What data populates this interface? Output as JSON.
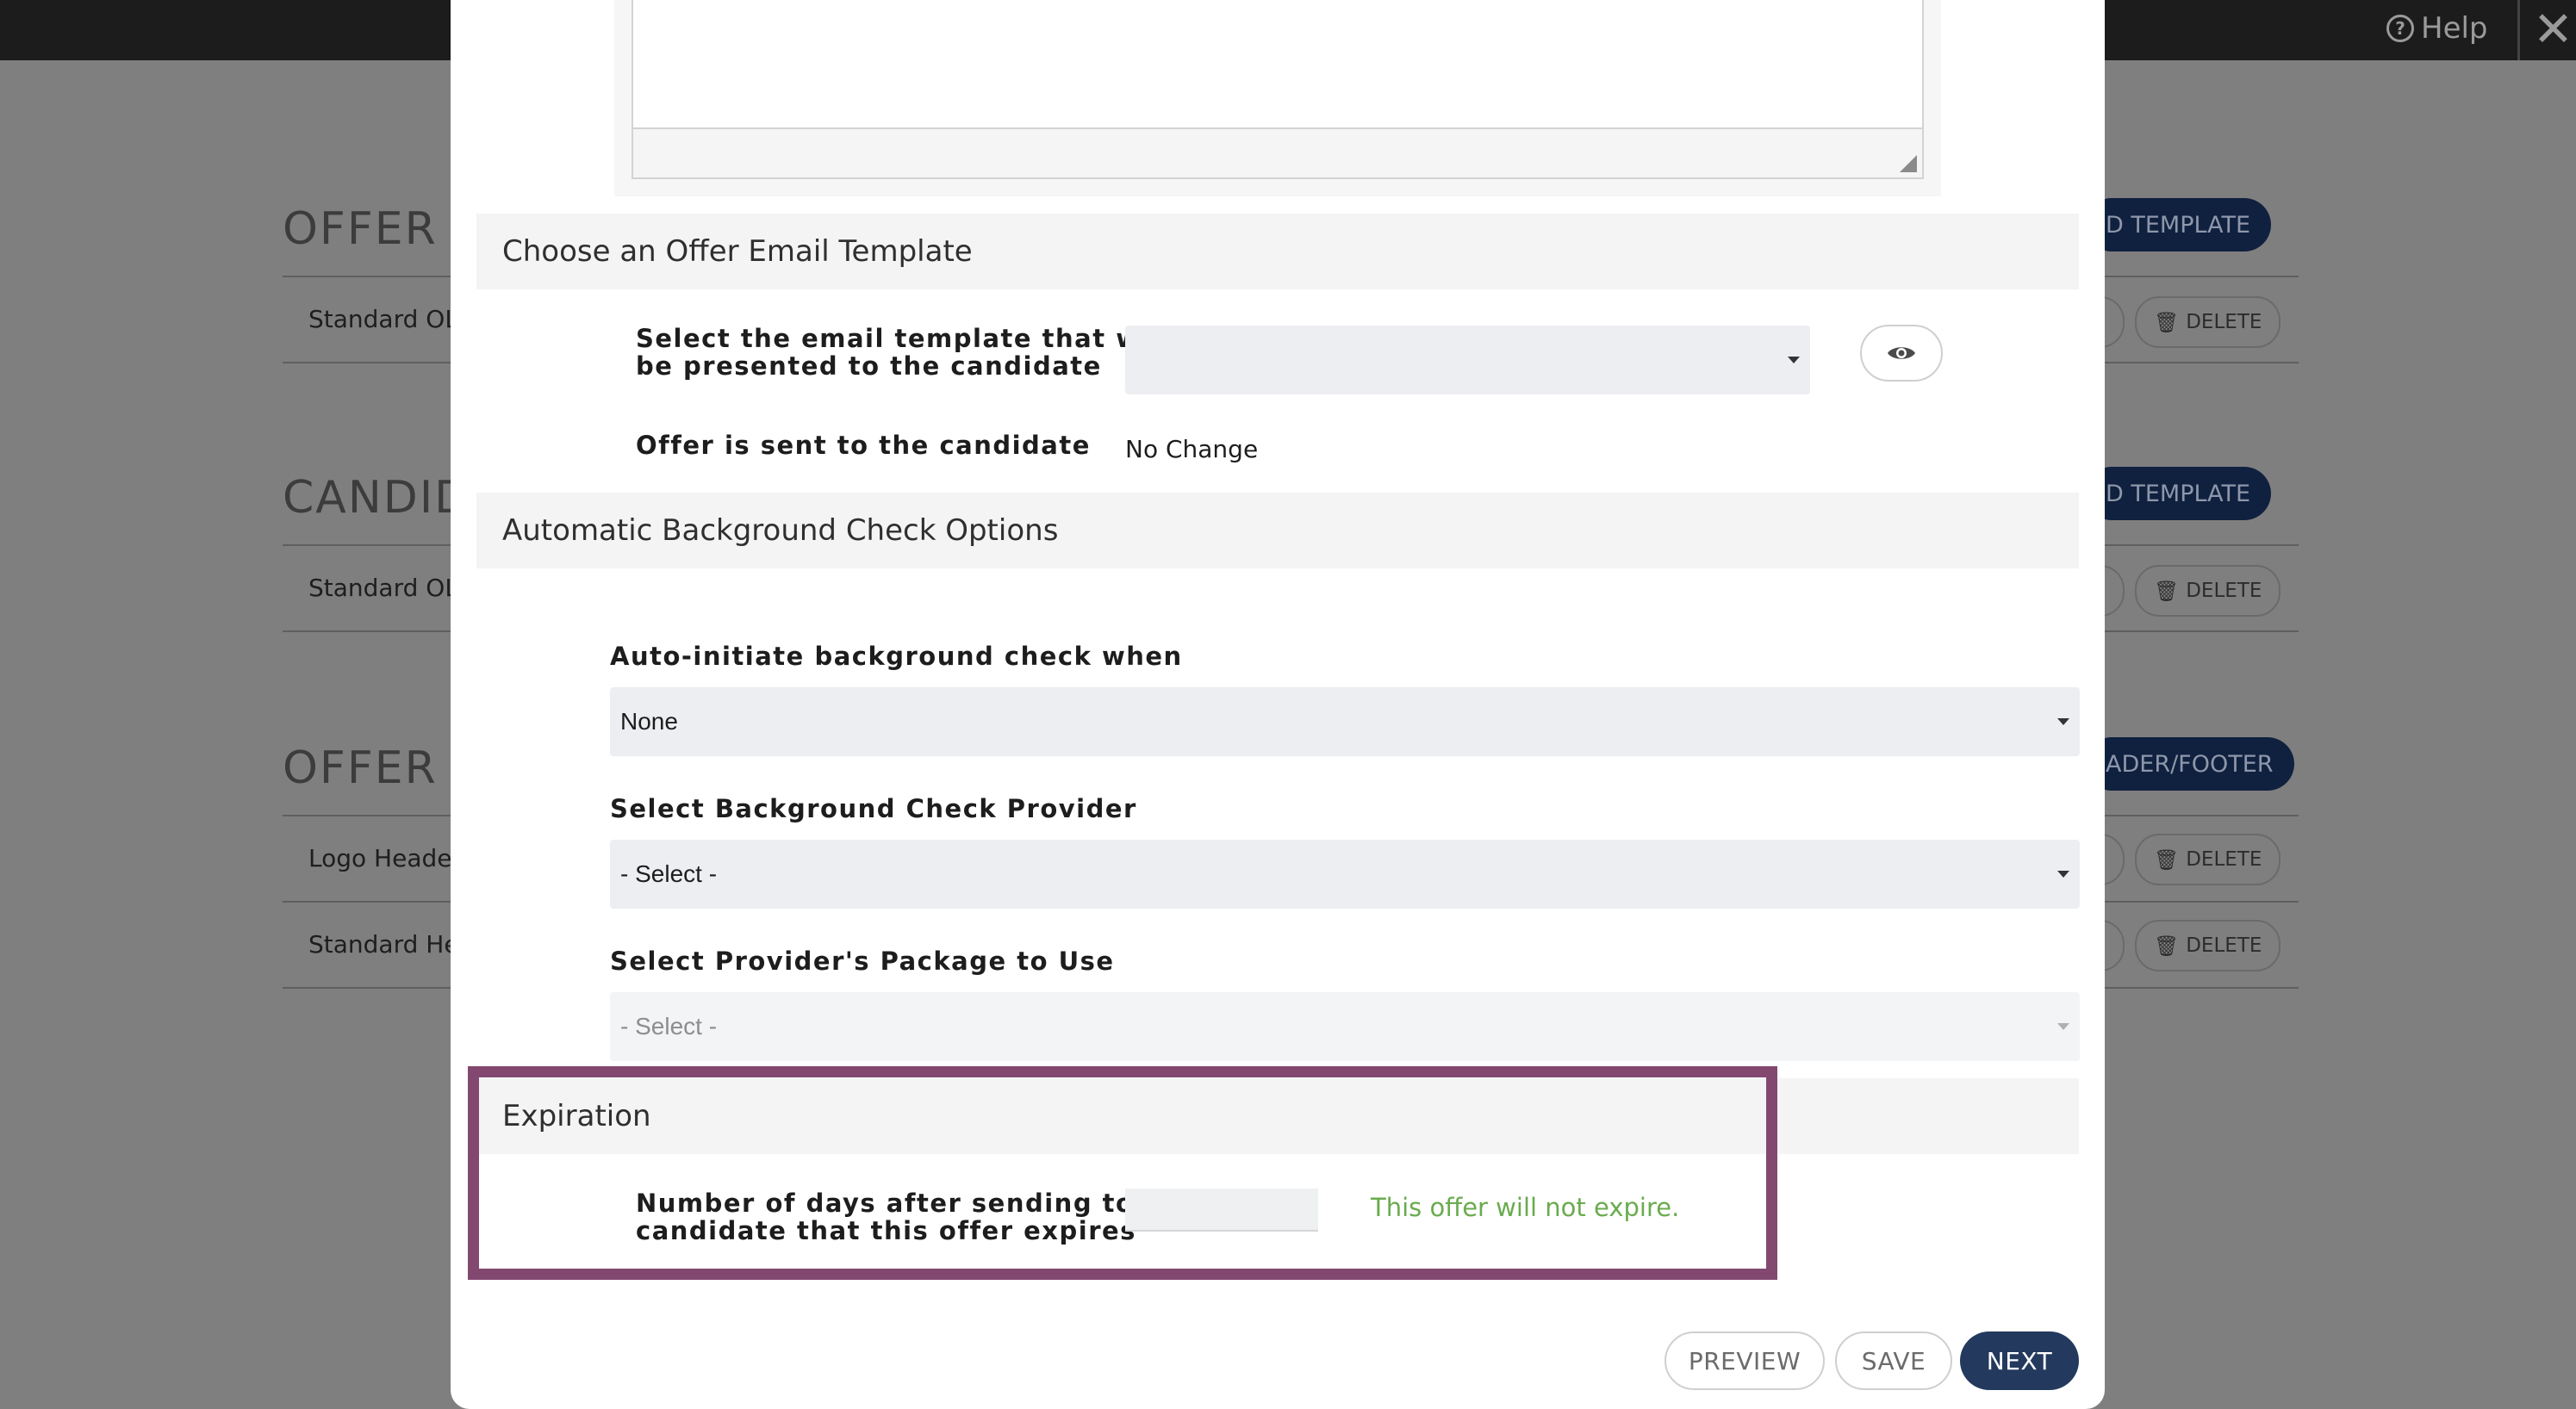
{
  "topbar": {
    "help_label": "Help",
    "help_icon": "?",
    "close_icon": "✕"
  },
  "background": {
    "sections": [
      {
        "title": "OFFER LE",
        "button": "D TEMPLATE",
        "rows": [
          "Standard OL"
        ]
      },
      {
        "title": "CANDIDA",
        "button": "D TEMPLATE",
        "rows": [
          "Standard OL"
        ]
      },
      {
        "title": "OFFER LE",
        "button": "ADER/FOOTER",
        "rows": [
          "Logo Header",
          "Standard He"
        ]
      }
    ],
    "delete_label": "DELETE"
  },
  "modal": {
    "email_section": {
      "title": "Choose an Offer Email Template",
      "template_label_line1": "Select the email template that will",
      "template_label_line2": "be presented to the candidate",
      "template_value": "",
      "sent_label": "Offer is sent to the candidate",
      "sent_value": "No Change"
    },
    "background_section": {
      "title": "Automatic Background Check Options",
      "auto_label": "Auto-initiate background check when",
      "auto_value": "None",
      "provider_label": "Select Background Check Provider",
      "provider_value": "- Select -",
      "package_label": "Select Provider's Package to Use",
      "package_value": "- Select -"
    },
    "expiration_section": {
      "title": "Expiration",
      "days_label_line1": "Number of days after sending to",
      "days_label_line2": "candidate that this offer expires",
      "days_value": "",
      "message": "This offer will not expire."
    },
    "footer": {
      "preview": "PREVIEW",
      "save": "SAVE",
      "next": "NEXT"
    }
  },
  "colors": {
    "primary": "#23395d",
    "highlight": "#834870",
    "success_text": "#6aab4f"
  }
}
